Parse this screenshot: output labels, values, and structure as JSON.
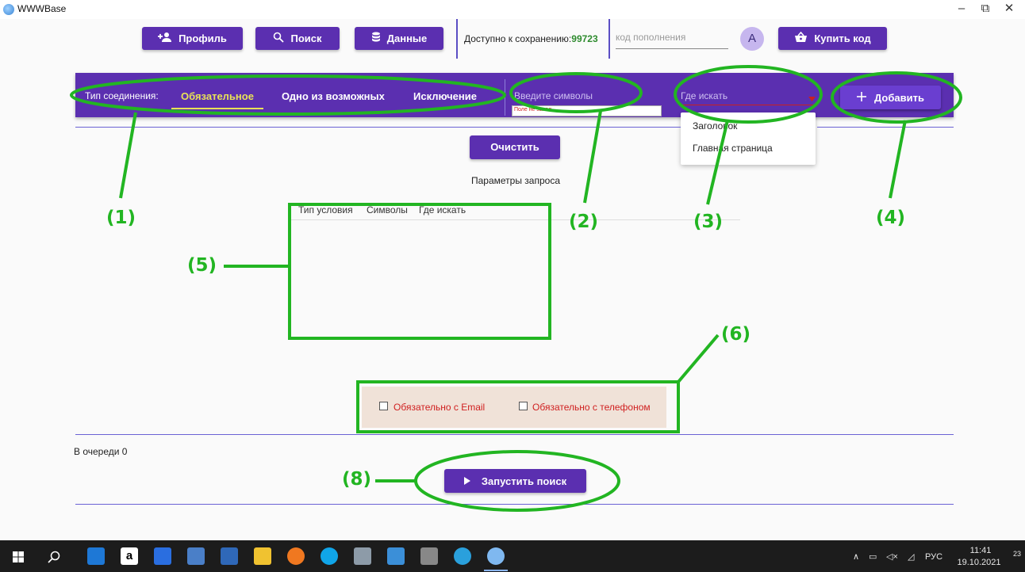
{
  "window": {
    "title": "WWWBase",
    "minimize": "–",
    "maximize": "⧉",
    "close": "✕"
  },
  "toolbar": {
    "profile": "Профиль",
    "search": "Поиск",
    "data": "Данные",
    "available_label": "Доступно к сохранению:",
    "available_value": "99723",
    "code_placeholder": "код пополнения",
    "avatar": "A",
    "buy": "Купить код"
  },
  "filter_bar": {
    "join_type_label": "Тип соединения:",
    "tabs": [
      "Обязательное",
      "Одно из возможных",
      "Исключение"
    ],
    "active_tab": "Обязательное",
    "symbols_placeholder": "Введите символы",
    "symbols_error": "Поле не запол",
    "where_placeholder": "Где искать",
    "add": "Добавить"
  },
  "where_dropdown": {
    "options": [
      "Заголовок",
      "Главная страница"
    ]
  },
  "main": {
    "clear": "Очистить",
    "params_title": "Параметры запроса",
    "columns": [
      "Тип условия",
      "Символы",
      "Где искать"
    ]
  },
  "checkboxes": [
    {
      "label": "Обязательно с Email",
      "checked": false
    },
    {
      "label": "Обязательно с телефоном",
      "checked": false
    }
  ],
  "footer": {
    "queue": "В очереди 0",
    "run": "Запустить поиск"
  },
  "annotations": [
    "(1)",
    "(2)",
    "(3)",
    "(4)",
    "(5)",
    "(6)",
    "(8)"
  ],
  "annotation_color": "#22b522",
  "accent_color": "#5b2fb0",
  "taskbar": {
    "lang": "РУС",
    "time": "11:41",
    "date": "19.10.2021",
    "notifications": "23",
    "icons": [
      "windows-start-icon",
      "search-icon",
      "mail-icon",
      "amazon-icon",
      "dropbox-icon",
      "app-icon",
      "store-icon",
      "file-explorer-icon",
      "firefox-icon",
      "skype-icon",
      "app-icon",
      "app-icon",
      "camera-app-icon",
      "telegram-icon",
      "wwwbase-icon"
    ]
  }
}
